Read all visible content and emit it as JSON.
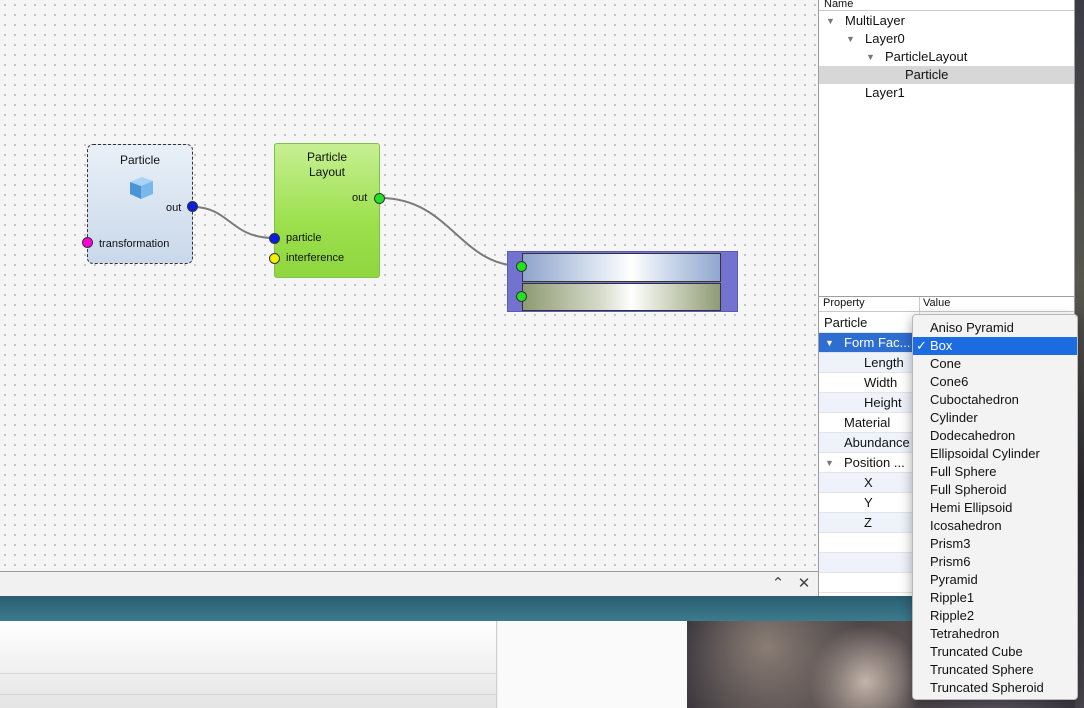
{
  "canvas": {
    "particle_node": {
      "title": "Particle",
      "out_label": "out",
      "transformation_label": "transformation"
    },
    "layout_node": {
      "title_line1": "Particle",
      "title_line2": "Layout",
      "out_label": "out",
      "particle_label": "particle",
      "interference_label": "interference"
    },
    "port_colors": {
      "out_blue": "#0a1ee0",
      "transformation_magenta": "#ff00dd",
      "particle_blue": "#0a1ee0",
      "interference_yellow": "#f2f200",
      "green": "#22e022"
    }
  },
  "dock": {
    "expand_icon": "chevron-up-icon",
    "close_icon": "close-icon"
  },
  "tree": {
    "header": "Name",
    "items": [
      {
        "label": "MultiLayer",
        "expanded": true
      },
      {
        "label": "Layer0",
        "expanded": true
      },
      {
        "label": "ParticleLayout",
        "expanded": true
      },
      {
        "label": "Particle",
        "selected": true
      },
      {
        "label": "Layer1"
      }
    ]
  },
  "properties": {
    "header_property": "Property",
    "header_value": "Value",
    "rows": [
      {
        "label": "Particle"
      },
      {
        "label": "Form Fac...",
        "selected": true,
        "expanded": true
      },
      {
        "label": "Length"
      },
      {
        "label": "Width"
      },
      {
        "label": "Height"
      },
      {
        "label": "Material"
      },
      {
        "label": "Abundance"
      },
      {
        "label": "Position ...",
        "expanded": true
      },
      {
        "label": "X"
      },
      {
        "label": "Y"
      },
      {
        "label": "Z"
      }
    ]
  },
  "dropdown": {
    "selected": "Box",
    "options": [
      "Aniso Pyramid",
      "Box",
      "Cone",
      "Cone6",
      "Cuboctahedron",
      "Cylinder",
      "Dodecahedron",
      "Ellipsoidal Cylinder",
      "Full Sphere",
      "Full Spheroid",
      "Hemi Ellipsoid",
      "Icosahedron",
      "Prism3",
      "Prism6",
      "Pyramid",
      "Ripple1",
      "Ripple2",
      "Tetrahedron",
      "Truncated Cube",
      "Truncated Sphere",
      "Truncated Spheroid"
    ],
    "selected_color": "#1d6be0"
  }
}
